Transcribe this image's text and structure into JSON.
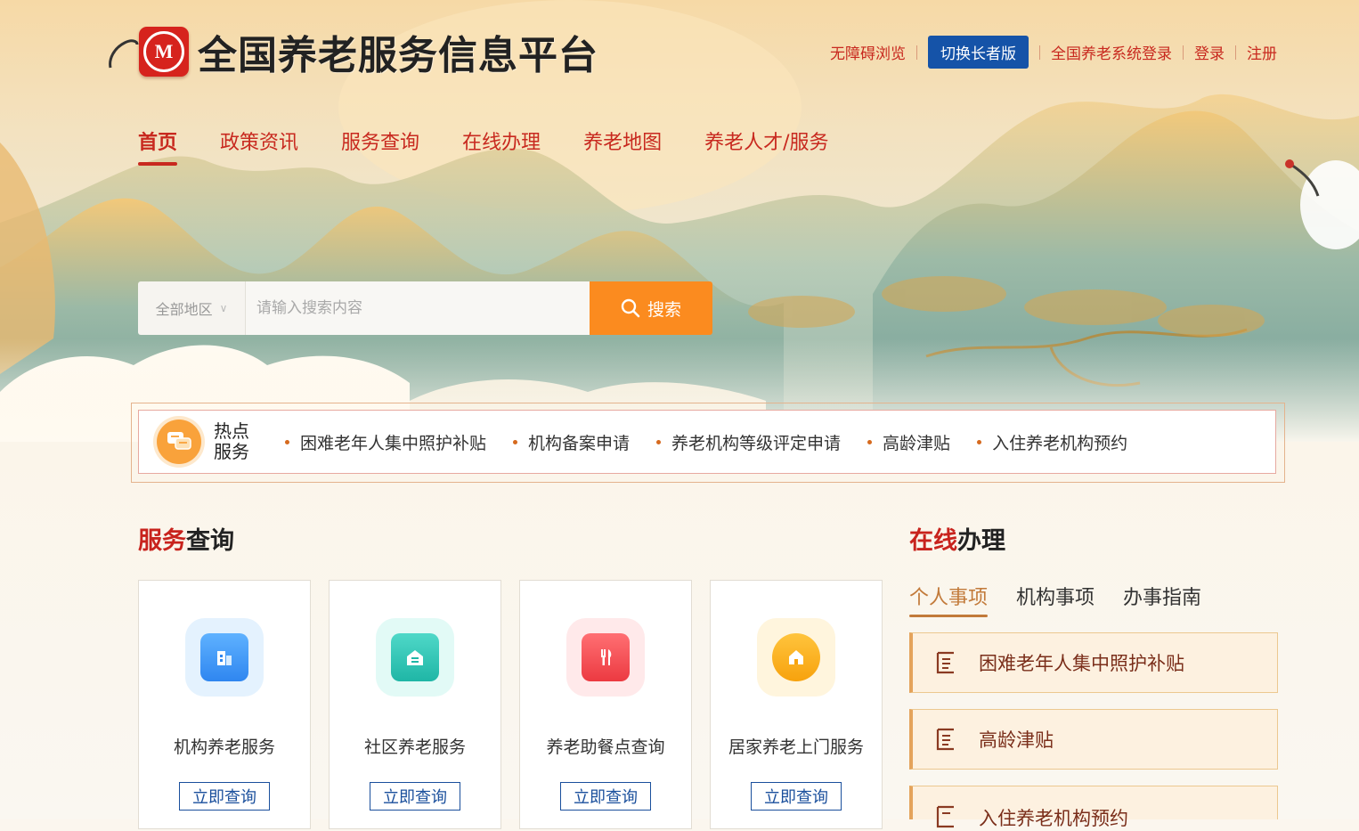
{
  "colors": {
    "brand_red": "#c8231d",
    "accent_orange": "#fb8b1f",
    "switch_blue": "#1553a8",
    "tab_active": "#c27a3a"
  },
  "header": {
    "logo_icon": "civil-affairs-emblem-icon",
    "title": "全国养老服务信息平台",
    "links": {
      "accessibility": "无障碍浏览",
      "elder_mode": "切换长者版",
      "system_login": "全国养老系统登录",
      "login": "登录",
      "register": "注册"
    }
  },
  "nav": {
    "items": [
      "首页",
      "政策资讯",
      "服务查询",
      "在线办理",
      "养老地图",
      "养老人才/服务"
    ],
    "active_index": 0
  },
  "search": {
    "region": "全部地区",
    "placeholder": "请输入搜索内容",
    "value": "",
    "button": "搜索"
  },
  "hot": {
    "label_line1": "热点",
    "label_line2": "服务",
    "items": [
      "困难老年人集中照护补贴",
      "机构备案申请",
      "养老机构等级评定申请",
      "高龄津贴",
      "入住养老机构预约"
    ]
  },
  "service_query": {
    "title_red": "服务",
    "title_black": "查询",
    "cards": [
      {
        "name": "机构养老服务",
        "button": "立即查询",
        "icon": "building-icon"
      },
      {
        "name": "社区养老服务",
        "button": "立即查询",
        "icon": "community-icon"
      },
      {
        "name": "养老助餐点查询",
        "button": "立即查询",
        "icon": "fork-knife-icon"
      },
      {
        "name": "居家养老上门服务",
        "button": "立即查询",
        "icon": "home-icon"
      }
    ]
  },
  "online": {
    "title_red": "在线",
    "title_black": "办理",
    "tabs": [
      "个人事项",
      "机构事项",
      "办事指南"
    ],
    "active_tab": 0,
    "items": [
      "困难老年人集中照护补贴",
      "高龄津贴",
      "入住养老机构预约"
    ]
  }
}
